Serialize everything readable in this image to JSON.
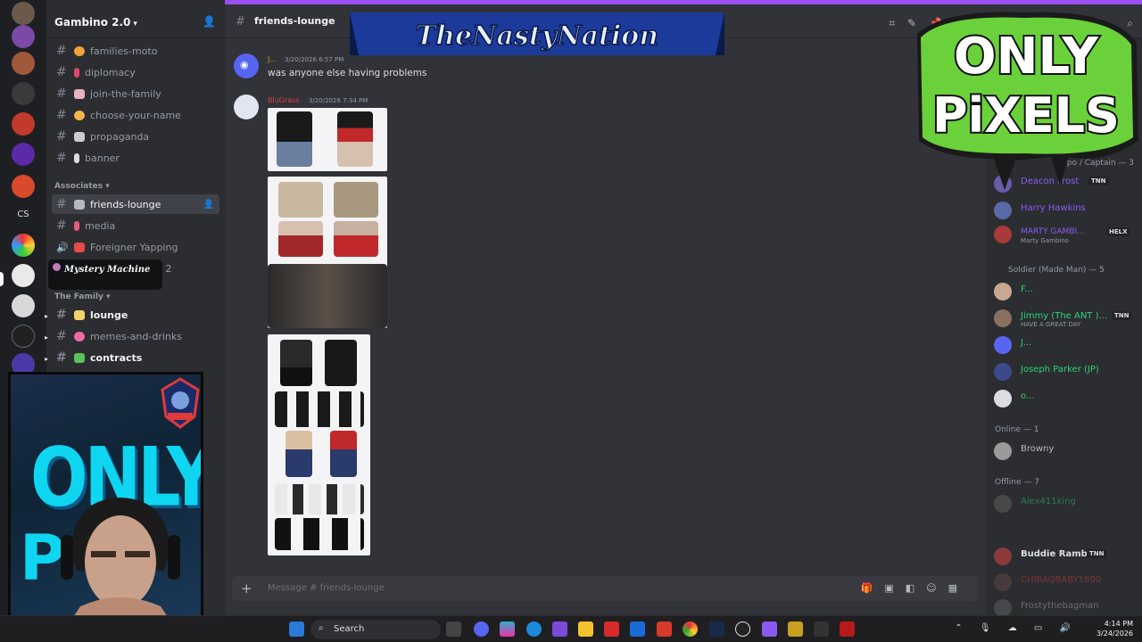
{
  "server": {
    "name": "Gambino 2.0",
    "rail_text": "CS"
  },
  "sidebar": {
    "channels_top": [
      {
        "label": "families-moto",
        "emoji_color": "#f0a23c"
      },
      {
        "label": "diplomacy",
        "emoji_color": "#e0456b"
      },
      {
        "label": "join-the-family",
        "emoji_color": "#e8b0c0"
      },
      {
        "label": "choose-your-name",
        "emoji_color": "#f2b64a"
      },
      {
        "label": "propaganda",
        "emoji_color": "#c9ccd1"
      },
      {
        "label": "banner",
        "emoji_color": "#dbdee1"
      }
    ],
    "category_associates": "Associates",
    "channels_mid": [
      {
        "label": "friends-lounge",
        "emoji_color": "#b5bac1"
      },
      {
        "label": "media",
        "emoji_color": "#e65a7a"
      },
      {
        "label": "Foreigner Yapping",
        "emoji_color": "#e84b4b"
      }
    ],
    "hidden_suffix": "g 2",
    "tooltip": "Mystery Machine",
    "category_family": "The Family",
    "channels_family": [
      {
        "label": "lounge",
        "emoji_color": "#f2d36b"
      },
      {
        "label": "memes-and-drinks",
        "emoji_color": "#f06aa5"
      },
      {
        "label": "contracts",
        "emoji_color": "#5cc05c"
      }
    ]
  },
  "header": {
    "channel": "friends-lounge",
    "banner_text": "TheNastyNation"
  },
  "messages": [
    {
      "author": "J...",
      "timestamp": "3/20/2026 6:57 PM",
      "text": "was anyone else having problems",
      "author_color": "#c9a227"
    },
    {
      "author": "BluGrass",
      "timestamp": "3/20/2026 7:34 PM",
      "text": "",
      "author_color": "#e03a3a"
    }
  ],
  "composer": {
    "placeholder": "Message #",
    "placeholder_channel": "friends-lounge"
  },
  "overlay": {
    "brand_line1": "ONLY",
    "brand_line2": "PiXELS",
    "cam_word1": "ONLY",
    "cam_word2": "P"
  },
  "members": {
    "role_partial": "Capo / Captain — 3",
    "role_capo": [
      {
        "name": "Deacon Frost",
        "color": "#8a5cf6",
        "tag": "TNN"
      },
      {
        "name": "Harry Hawkins",
        "color": "#8a5cf6",
        "tag": ""
      },
      {
        "name": "MARTY GAMBI...",
        "color": "#8a5cf6",
        "tag": "HELX",
        "sub": "Marty Gambino"
      }
    ],
    "role_soldier": "Soldier (Made Man) — 5",
    "soldiers": [
      {
        "name": "F...",
        "color": "#2fd27a",
        "tag": "",
        "sub": ""
      },
      {
        "name": "Jimmy (The ANT )...",
        "color": "#2fd27a",
        "tag": "TNN",
        "sub": "HAVE A GREAT DAY"
      },
      {
        "name": "J...",
        "color": "#2fd27a",
        "tag": "",
        "sub": ""
      },
      {
        "name": "Joseph Parker (JP)",
        "color": "#2fd27a",
        "tag": "",
        "sub": ""
      },
      {
        "name": "o...",
        "color": "#2fd27a",
        "tag": "",
        "sub": ""
      }
    ],
    "online_label": "Online — 1",
    "online": [
      {
        "name": "Browny",
        "color": "#b5bac1"
      }
    ],
    "offline_label": "Offline — 7",
    "offline": [
      {
        "name": "Alex411king",
        "color": "#2fd27a"
      },
      {
        "name": "Buddie Rambo",
        "color": "#dbdee1",
        "tag": "TNN"
      },
      {
        "name": "CHIRAQBABY1800",
        "color": "#e03a3a"
      },
      {
        "name": "Frostythebagman",
        "color": "#b5bac1"
      }
    ]
  },
  "taskbar": {
    "search": "Search",
    "time": "4:14 PM",
    "date": "3/24/2026"
  }
}
